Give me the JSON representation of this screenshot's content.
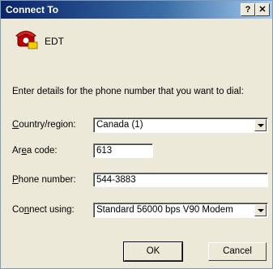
{
  "window": {
    "title": "Connect To",
    "help_label": "?",
    "close_label": "✕"
  },
  "connection": {
    "name": "EDT",
    "icon": "telephone-icon"
  },
  "prompt": "Enter details for the phone number that you want to dial:",
  "country": {
    "label_pre": "",
    "label_u": "C",
    "label_post": "ountry/region:",
    "value": "Canada (1)"
  },
  "area": {
    "label_pre": "Ar",
    "label_u": "e",
    "label_post": "a code:",
    "value": "613"
  },
  "phone": {
    "label_pre": "",
    "label_u": "P",
    "label_post": "hone number:",
    "value": "544-3883"
  },
  "device": {
    "label_pre": "Co",
    "label_u": "n",
    "label_post": "nect using:",
    "value": "Standard 56000 bps V90 Modem"
  },
  "buttons": {
    "ok": "OK",
    "cancel": "Cancel"
  }
}
